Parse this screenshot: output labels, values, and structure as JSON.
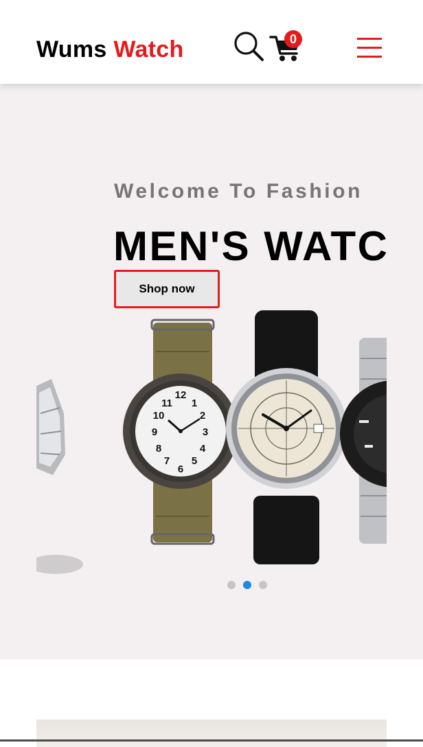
{
  "header": {
    "brand_part1": "Wums",
    "brand_part2": "Watch",
    "cart_count": "0",
    "icons": {
      "search": "search-icon",
      "cart": "cart-icon",
      "menu": "hamburger-menu-icon"
    }
  },
  "hero": {
    "welcome_text": "Welcome To Fashion",
    "headline": "MEN'S WATCHES",
    "shop_button_label": "Shop now",
    "watches": [
      "steel-bracelet-watch",
      "olive-nato-strap-watch",
      "black-leather-strap-watch",
      "diver-watch"
    ],
    "slides": 3,
    "active_slide": 2
  },
  "colors": {
    "brand_accent": "#e51b1b",
    "hero_background": "#f4f0f1",
    "active_dot": "#1e88e5",
    "inactive_dot": "#c7c4c5"
  }
}
